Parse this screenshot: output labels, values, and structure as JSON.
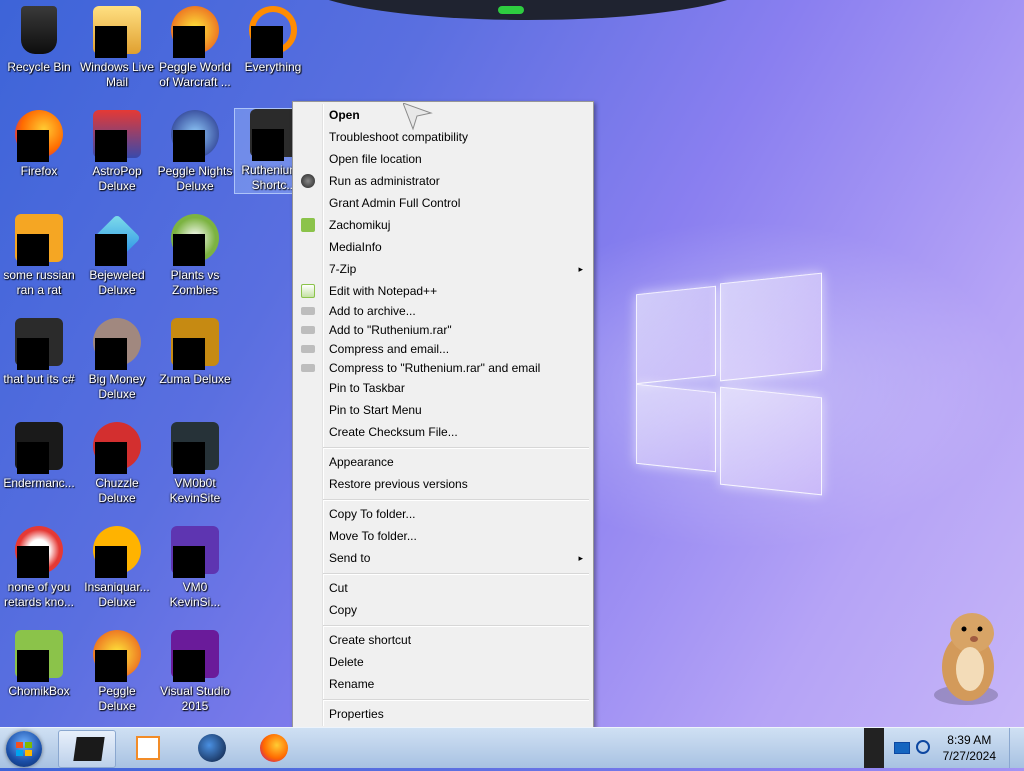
{
  "desktop": {
    "icons": [
      {
        "label": "Recycle Bin"
      },
      {
        "label": "Windows Live Mail"
      },
      {
        "label": "Peggle World of Warcraft ..."
      },
      {
        "label": "Everything"
      },
      {
        "label": "Firefox"
      },
      {
        "label": "AstroPop Deluxe"
      },
      {
        "label": "Peggle Nights Deluxe"
      },
      {
        "label": "Ruthenium - Shortc..."
      },
      {
        "label": "some russian ran a rat"
      },
      {
        "label": "Bejeweled Deluxe"
      },
      {
        "label": "Plants vs Zombies"
      },
      {
        "label": "that but its c#"
      },
      {
        "label": "Big Money Deluxe"
      },
      {
        "label": "Zuma Deluxe"
      },
      {
        "label": "Endermanc..."
      },
      {
        "label": "Chuzzle Deluxe"
      },
      {
        "label": "VM0b0t KevinSite"
      },
      {
        "label": "none of you retards kno..."
      },
      {
        "label": "Insaniquar... Deluxe"
      },
      {
        "label": "VM0 KevinSi..."
      },
      {
        "label": "ChomikBox"
      },
      {
        "label": "Peggle Deluxe"
      },
      {
        "label": "Visual Studio 2015"
      }
    ]
  },
  "context_menu": {
    "items": [
      {
        "label": "Open"
      },
      {
        "label": "Troubleshoot compatibility"
      },
      {
        "label": "Open file location"
      },
      {
        "label": "Run as administrator"
      },
      {
        "label": "Grant Admin Full Control"
      },
      {
        "label": "Zachomikuj"
      },
      {
        "label": "MediaInfo"
      },
      {
        "label": "7-Zip"
      },
      {
        "label": "Edit with Notepad++"
      },
      {
        "label": "Add to archive..."
      },
      {
        "label": "Add to \"Ruthenium.rar\""
      },
      {
        "label": "Compress and email..."
      },
      {
        "label": "Compress to \"Ruthenium.rar\" and email"
      },
      {
        "label": "Pin to Taskbar"
      },
      {
        "label": "Pin to Start Menu"
      },
      {
        "label": "Create Checksum File..."
      },
      {
        "label": "Appearance"
      },
      {
        "label": "Restore previous versions"
      },
      {
        "label": "Copy To folder..."
      },
      {
        "label": "Move To folder..."
      },
      {
        "label": "Send to"
      },
      {
        "label": "Cut"
      },
      {
        "label": "Copy"
      },
      {
        "label": "Create shortcut"
      },
      {
        "label": "Delete"
      },
      {
        "label": "Rename"
      },
      {
        "label": "Properties"
      }
    ],
    "submenu_arrow": "▸"
  },
  "taskbar": {
    "pinned": [
      {
        "name": "terminal-icon"
      },
      {
        "name": "media-player-icon"
      },
      {
        "name": "globe-icon"
      },
      {
        "name": "firefox-icon"
      }
    ],
    "clock": {
      "time": "8:39 AM",
      "date": "7/27/2024"
    }
  },
  "colors": {
    "menu_bg": "#f0f0f0",
    "taskbar_top": "#cfe0f3",
    "desktop_accent": "#5a6fe0"
  }
}
